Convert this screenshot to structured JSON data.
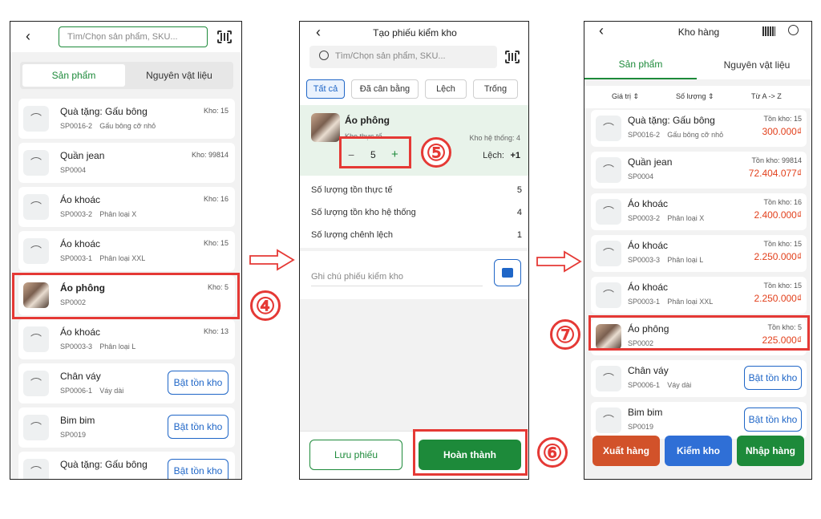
{
  "screen1": {
    "search_placeholder": "Tìm/Chọn sản phẩm, SKU...",
    "tabs": [
      "Sản phẩm",
      "Nguyên vật liệu"
    ],
    "items": [
      {
        "name": "Quà tặng: Gấu bông",
        "sku": "SP0016-2",
        "variant": "Gấu bông cỡ nhỏ",
        "stock": "Kho: 15"
      },
      {
        "name": "Quần jean",
        "sku": "SP0004",
        "variant": "",
        "stock": "Kho: 99814"
      },
      {
        "name": "Áo khoác",
        "sku": "SP0003-2",
        "variant": "Phân loại X",
        "stock": "Kho: 16"
      },
      {
        "name": "Áo khoác",
        "sku": "SP0003-1",
        "variant": "Phân loại XXL",
        "stock": "Kho: 15"
      },
      {
        "name": "Áo phông",
        "sku": "SP0002",
        "variant": "",
        "stock": "Kho: 5"
      },
      {
        "name": "Áo khoác",
        "sku": "SP0003-3",
        "variant": "Phân loại L",
        "stock": "Kho: 13"
      },
      {
        "name": "Chân váy",
        "sku": "SP0006-1",
        "variant": "Váy dài",
        "stock": "Bật tồn kho"
      },
      {
        "name": "Bim bim",
        "sku": "SP0019",
        "variant": "",
        "stock": "Bật tồn kho"
      },
      {
        "name": "Quà tặng: Gấu bông",
        "sku": "",
        "variant": "",
        "stock": "Bật tồn kho"
      }
    ]
  },
  "screen2": {
    "title": "Tạo phiếu kiểm kho",
    "search_placeholder": "Tìm/Chọn sản phẩm, SKU...",
    "filters": [
      "Tất cả",
      "Đã cân bằng",
      "Lệch",
      "Trống"
    ],
    "product": {
      "name": "Áo phông",
      "actual_label": "Kho thực tế",
      "system_label": "Kho hệ thống: 4",
      "qty": "5",
      "diff_label": "Lệch:",
      "diff_value": "+1",
      "minus": "−",
      "plus": "+"
    },
    "summary": [
      {
        "label": "Số lượng tồn thực tế",
        "value": "5"
      },
      {
        "label": "Số lượng tồn kho hệ thống",
        "value": "4"
      },
      {
        "label": "Số lượng chênh lệch",
        "value": "1"
      }
    ],
    "note_placeholder": "Ghi chú phiếu kiểm kho",
    "save_label": "Lưu phiếu",
    "done_label": "Hoàn thành"
  },
  "screen3": {
    "title": "Kho hàng",
    "tabs": [
      "Sản phẩm",
      "Nguyên vật liệu"
    ],
    "sorts": [
      "Giá trị",
      "Số lượng",
      "Từ A -> Z"
    ],
    "items": [
      {
        "name": "Quà tặng: Gấu bông",
        "sku": "SP0016-2",
        "variant": "Gấu bông cỡ nhỏ",
        "stock": "Tồn kho: 15",
        "value": "300.000₫"
      },
      {
        "name": "Quần jean",
        "sku": "SP0004",
        "variant": "",
        "stock": "Tồn kho: 99814",
        "value": "72.404.077₫"
      },
      {
        "name": "Áo khoác",
        "sku": "SP0003-2",
        "variant": "Phân loại X",
        "stock": "Tồn kho: 16",
        "value": "2.400.000₫"
      },
      {
        "name": "Áo khoác",
        "sku": "SP0003-3",
        "variant": "Phân loại L",
        "stock": "Tồn kho: 15",
        "value": "2.250.000₫"
      },
      {
        "name": "Áo khoác",
        "sku": "SP0003-1",
        "variant": "Phân loại XXL",
        "stock": "Tồn kho: 15",
        "value": "2.250.000₫"
      },
      {
        "name": "Áo phông",
        "sku": "SP0002",
        "variant": "",
        "stock": "Tồn kho: 5",
        "value": "225.000₫"
      },
      {
        "name": "Chân váy",
        "sku": "SP0006-1",
        "variant": "Váy dài",
        "stock": "Bật tồn kho",
        "value": ""
      },
      {
        "name": "Bim bim",
        "sku": "SP0019",
        "variant": "",
        "stock": "Bật tồn kho",
        "value": ""
      }
    ],
    "actions": [
      "Xuất hàng",
      "Kiểm kho",
      "Nhập hàng"
    ],
    "action_colors": [
      "#d2522a",
      "#2f6fd6",
      "#1d8a3a"
    ]
  },
  "steps": [
    "④",
    "⑤",
    "⑥",
    "⑦"
  ],
  "colors": {
    "accent_green": "#1d8a3a",
    "highlight_red": "#e53935",
    "link_blue": "#1f66c7"
  }
}
